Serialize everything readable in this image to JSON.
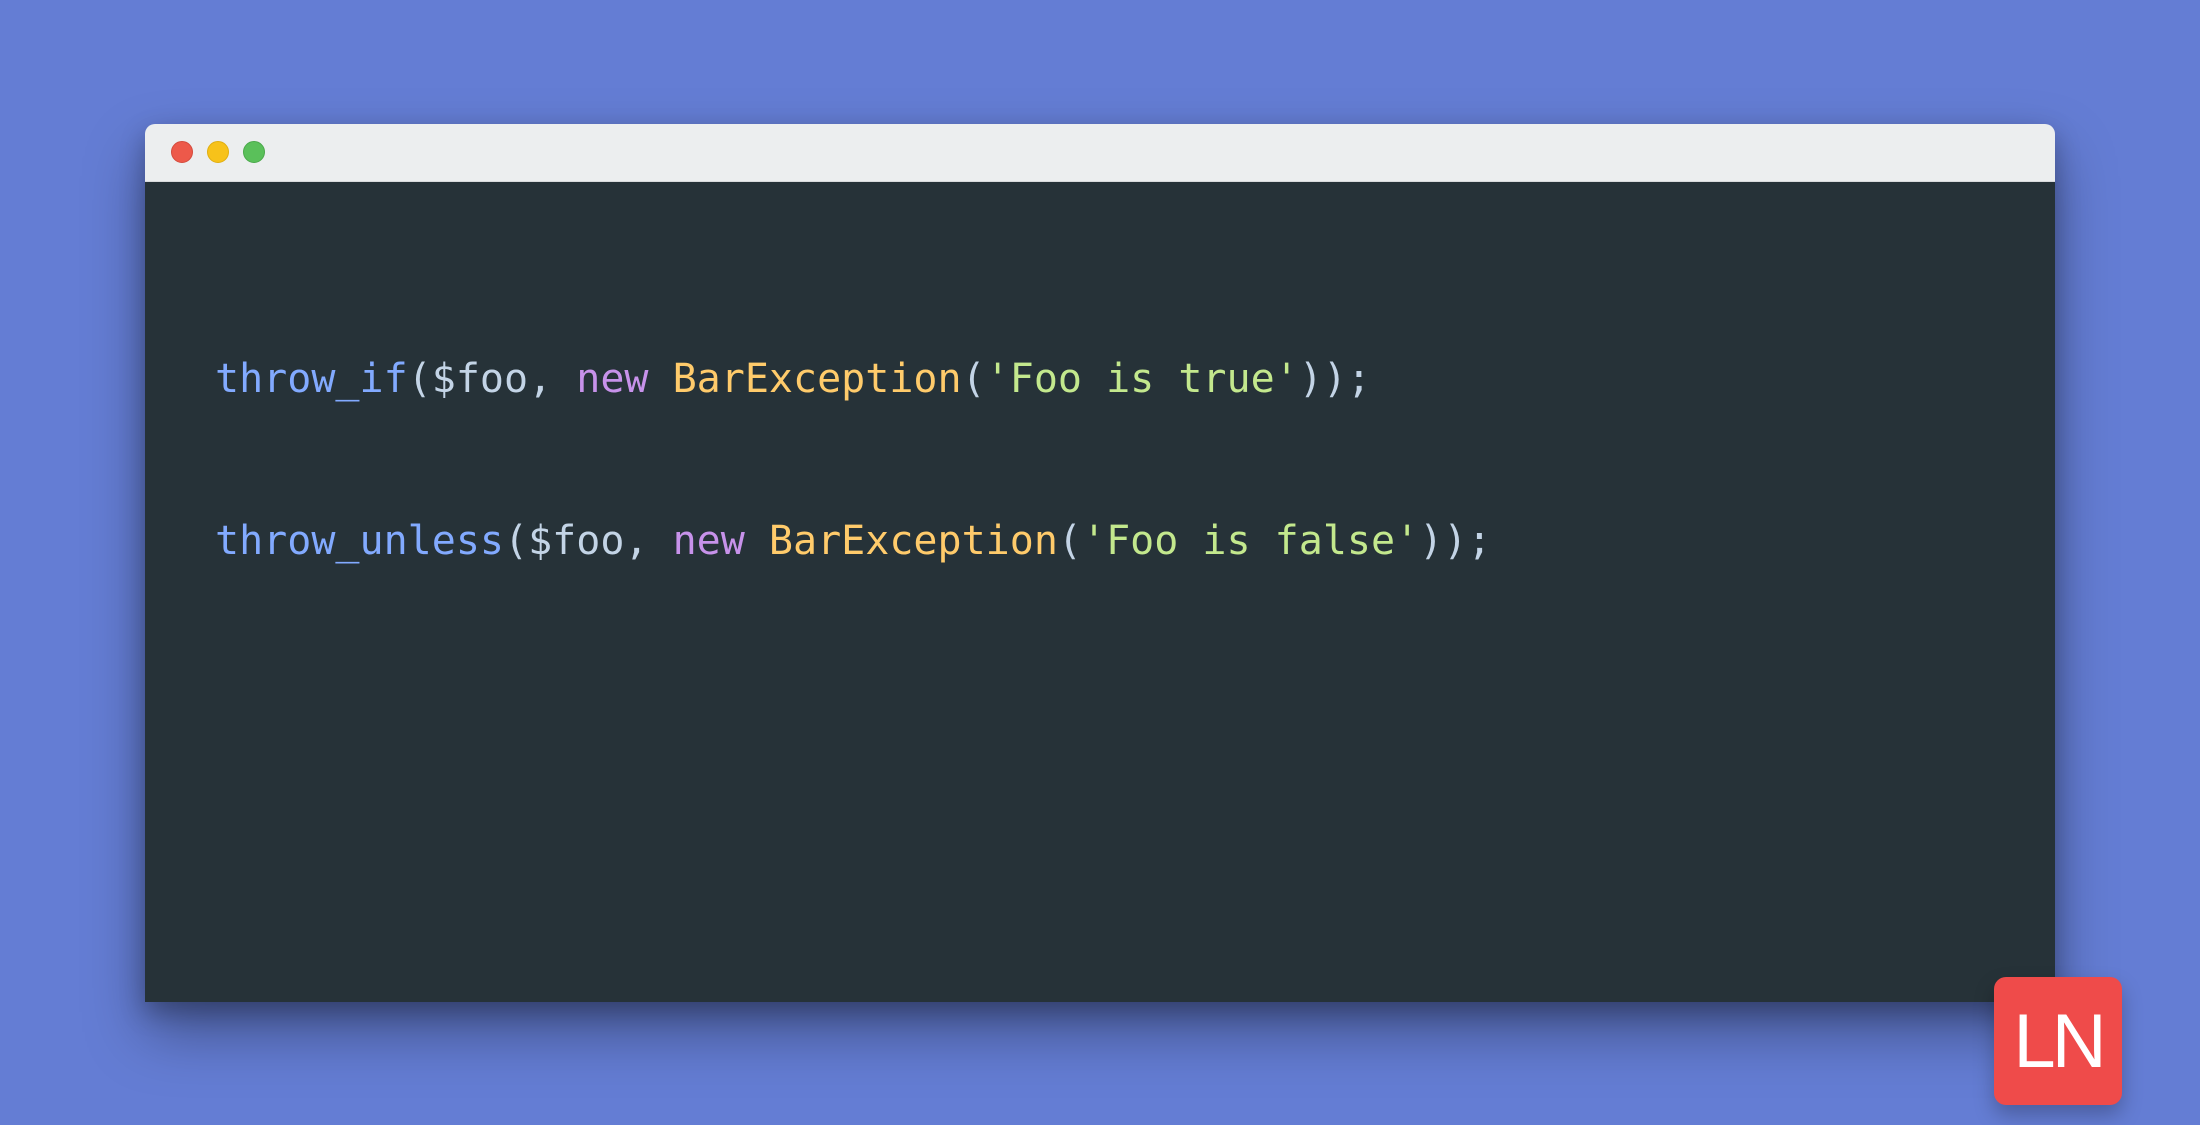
{
  "colors": {
    "background": "#647dd4",
    "editor_bg": "#263238",
    "titlebar_bg": "#eceeef",
    "badge_bg": "#ef4b4a",
    "traffic_red": "#ed594a",
    "traffic_yellow": "#f7c21a",
    "traffic_green": "#5ac05a"
  },
  "badge": {
    "text": "LN"
  },
  "code": {
    "lines": [
      {
        "tokens": [
          {
            "cls": "tok-fn",
            "text": "throw_if"
          },
          {
            "cls": "tok-punc",
            "text": "("
          },
          {
            "cls": "tok-var",
            "text": "$foo"
          },
          {
            "cls": "tok-punc",
            "text": ", "
          },
          {
            "cls": "tok-kw",
            "text": "new"
          },
          {
            "cls": "tok-punc",
            "text": " "
          },
          {
            "cls": "tok-class",
            "text": "BarException"
          },
          {
            "cls": "tok-punc",
            "text": "("
          },
          {
            "cls": "tok-str",
            "text": "'Foo is true'"
          },
          {
            "cls": "tok-punc",
            "text": "));"
          }
        ]
      },
      {
        "tokens": []
      },
      {
        "tokens": []
      },
      {
        "tokens": [
          {
            "cls": "tok-fn",
            "text": "throw_unless"
          },
          {
            "cls": "tok-punc",
            "text": "("
          },
          {
            "cls": "tok-var",
            "text": "$foo"
          },
          {
            "cls": "tok-punc",
            "text": ", "
          },
          {
            "cls": "tok-kw",
            "text": "new"
          },
          {
            "cls": "tok-punc",
            "text": " "
          },
          {
            "cls": "tok-class",
            "text": "BarException"
          },
          {
            "cls": "tok-punc",
            "text": "("
          },
          {
            "cls": "tok-str",
            "text": "'Foo is false'"
          },
          {
            "cls": "tok-punc",
            "text": "));"
          }
        ]
      }
    ]
  }
}
